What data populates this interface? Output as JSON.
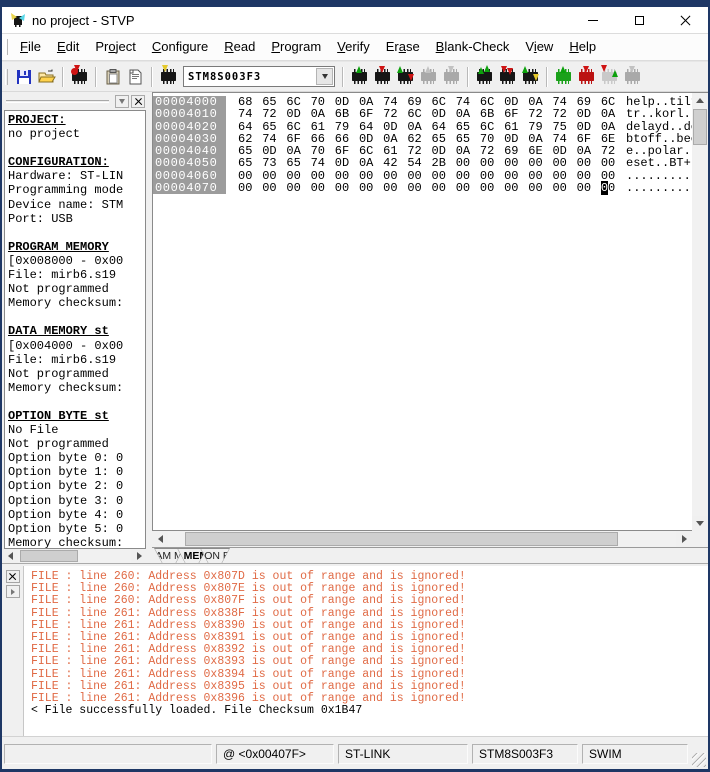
{
  "window": {
    "title": "no project - STVP"
  },
  "menu": {
    "items": [
      {
        "label": "File",
        "u": 0
      },
      {
        "label": "Edit",
        "u": 0
      },
      {
        "label": "Project",
        "u": 2
      },
      {
        "label": "Configure",
        "u": 0
      },
      {
        "label": "Read",
        "u": 0
      },
      {
        "label": "Program",
        "u": 0
      },
      {
        "label": "Verify",
        "u": 0
      },
      {
        "label": "Erase",
        "u": 2
      },
      {
        "label": "Blank-Check",
        "u": 0
      },
      {
        "label": "View",
        "u": 1
      },
      {
        "label": "Help",
        "u": 0
      }
    ]
  },
  "toolbar": {
    "device_value": "STM8S003F3",
    "icons": [
      "save-icon",
      "open-icon",
      "device-setup-icon",
      "paste-icon",
      "file-report-icon",
      "select-device-icon",
      "read-tab-chip-icon",
      "program-tab-chip-icon",
      "verify-tab-chip-icon",
      "erase-tab-chip-icon",
      "blank-check-tab-chip-icon",
      "read-all-tabs-chip-icon",
      "program-all-tabs-chip-icon",
      "verify-all-tabs-chip-icon",
      "auto-read-chip-icon",
      "auto-program-chip-icon",
      "compare-chip-icon",
      "spare-chip-icon"
    ]
  },
  "sidebar": {
    "lines": [
      {
        "text": "PROJECT:",
        "heading": true
      },
      {
        "text": "no project"
      },
      {
        "text": ""
      },
      {
        "text": "CONFIGURATION:",
        "heading": true
      },
      {
        "text": "Hardware: ST-LIN"
      },
      {
        "text": "Programming mode"
      },
      {
        "text": "Device name: STM"
      },
      {
        "text": "Port: USB"
      },
      {
        "text": ""
      },
      {
        "text": "PROGRAM MEMORY",
        "heading": true
      },
      {
        "text": "[0x008000 - 0x00"
      },
      {
        "text": "File: mirb6.s19"
      },
      {
        "text": "Not programmed"
      },
      {
        "text": "Memory checksum:"
      },
      {
        "text": ""
      },
      {
        "text": "DATA MEMORY st",
        "heading": true
      },
      {
        "text": "[0x004000 - 0x00"
      },
      {
        "text": "File: mirb6.s19"
      },
      {
        "text": "Not programmed"
      },
      {
        "text": "Memory checksum:"
      },
      {
        "text": ""
      },
      {
        "text": "OPTION BYTE st",
        "heading": true
      },
      {
        "text": "No File"
      },
      {
        "text": "Not programmed"
      },
      {
        "text": "Option byte 0: 0"
      },
      {
        "text": "Option byte 1: 0"
      },
      {
        "text": "Option byte 2: 0"
      },
      {
        "text": "Option byte 3: 0"
      },
      {
        "text": "Option byte 4: 0"
      },
      {
        "text": "Option byte 5: 0"
      },
      {
        "text": "Memory checksum:"
      }
    ]
  },
  "hex_view": {
    "rows": [
      {
        "addr": "00004000",
        "bytes": [
          "68",
          "65",
          "6C",
          "70",
          "0D",
          "0A",
          "74",
          "69",
          "6C",
          "74",
          "6C",
          "0D",
          "0A",
          "74",
          "69",
          "6C"
        ],
        "ascii": "help..tiltl..til"
      },
      {
        "addr": "00004010",
        "bytes": [
          "74",
          "72",
          "0D",
          "0A",
          "6B",
          "6F",
          "72",
          "6C",
          "0D",
          "0A",
          "6B",
          "6F",
          "72",
          "72",
          "0D",
          "0A"
        ],
        "ascii": "tr..korl..korr.."
      },
      {
        "addr": "00004020",
        "bytes": [
          "64",
          "65",
          "6C",
          "61",
          "79",
          "64",
          "0D",
          "0A",
          "64",
          "65",
          "6C",
          "61",
          "79",
          "75",
          "0D",
          "0A"
        ],
        "ascii": "delayd..delayu.."
      },
      {
        "addr": "00004030",
        "bytes": [
          "62",
          "74",
          "6F",
          "66",
          "66",
          "0D",
          "0A",
          "62",
          "65",
          "65",
          "70",
          "0D",
          "0A",
          "74",
          "6F",
          "6E"
        ],
        "ascii": "btoff..beep..ton"
      },
      {
        "addr": "00004040",
        "bytes": [
          "65",
          "0D",
          "0A",
          "70",
          "6F",
          "6C",
          "61",
          "72",
          "0D",
          "0A",
          "72",
          "69",
          "6E",
          "0D",
          "0A",
          "72"
        ],
        "ascii": "e..polar..rin..r"
      },
      {
        "addr": "00004050",
        "bytes": [
          "65",
          "73",
          "65",
          "74",
          "0D",
          "0A",
          "42",
          "54",
          "2B",
          "00",
          "00",
          "00",
          "00",
          "00",
          "00",
          "00"
        ],
        "ascii": "eset..BT+......."
      },
      {
        "addr": "00004060",
        "bytes": [
          "00",
          "00",
          "00",
          "00",
          "00",
          "00",
          "00",
          "00",
          "00",
          "00",
          "00",
          "00",
          "00",
          "00",
          "00",
          "00"
        ],
        "ascii": "................"
      },
      {
        "addr": "00004070",
        "bytes": [
          "00",
          "00",
          "00",
          "00",
          "00",
          "00",
          "00",
          "00",
          "00",
          "00",
          "00",
          "00",
          "00",
          "00",
          "00",
          "00"
        ],
        "ascii": "................"
      }
    ],
    "cursor": {
      "row": 7,
      "byte": 15,
      "nibble": 0
    }
  },
  "tabs": {
    "items": [
      {
        "label": "PROGRAM MEMORY",
        "active": false
      },
      {
        "label": "DATA MEMORY",
        "active": true
      },
      {
        "label": "OPTION BYTE",
        "active": false
      }
    ]
  },
  "log": {
    "lines": [
      {
        "text": "FILE : line 260: Address 0x807D is out of range and is ignored!",
        "type": "error"
      },
      {
        "text": "FILE : line 260: Address 0x807E is out of range and is ignored!",
        "type": "error"
      },
      {
        "text": "FILE : line 260: Address 0x807F is out of range and is ignored!",
        "type": "error"
      },
      {
        "text": "FILE : line 261: Address 0x838F is out of range and is ignored!",
        "type": "error"
      },
      {
        "text": "FILE : line 261: Address 0x8390 is out of range and is ignored!",
        "type": "error"
      },
      {
        "text": "FILE : line 261: Address 0x8391 is out of range and is ignored!",
        "type": "error"
      },
      {
        "text": "FILE : line 261: Address 0x8392 is out of range and is ignored!",
        "type": "error"
      },
      {
        "text": "FILE : line 261: Address 0x8393 is out of range and is ignored!",
        "type": "error"
      },
      {
        "text": "FILE : line 261: Address 0x8394 is out of range and is ignored!",
        "type": "error"
      },
      {
        "text": "FILE : line 261: Address 0x8395 is out of range and is ignored!",
        "type": "error"
      },
      {
        "text": "FILE : line 261: Address 0x8396 is out of range and is ignored!",
        "type": "error"
      },
      {
        "text": "< File successfully loaded. File Checksum 0x1B47",
        "type": "info"
      }
    ]
  },
  "status_bar": {
    "cells": [
      "",
      "@ <0x00407F>",
      "ST-LINK",
      "STM8S003F3",
      "SWIM"
    ]
  },
  "colors": {
    "window_border": "#1e3765",
    "log_error": "#e06a45",
    "hex_address_bg": "#9c9c9c",
    "chip_green": "#1ba11b",
    "chip_red": "#bb1212"
  }
}
